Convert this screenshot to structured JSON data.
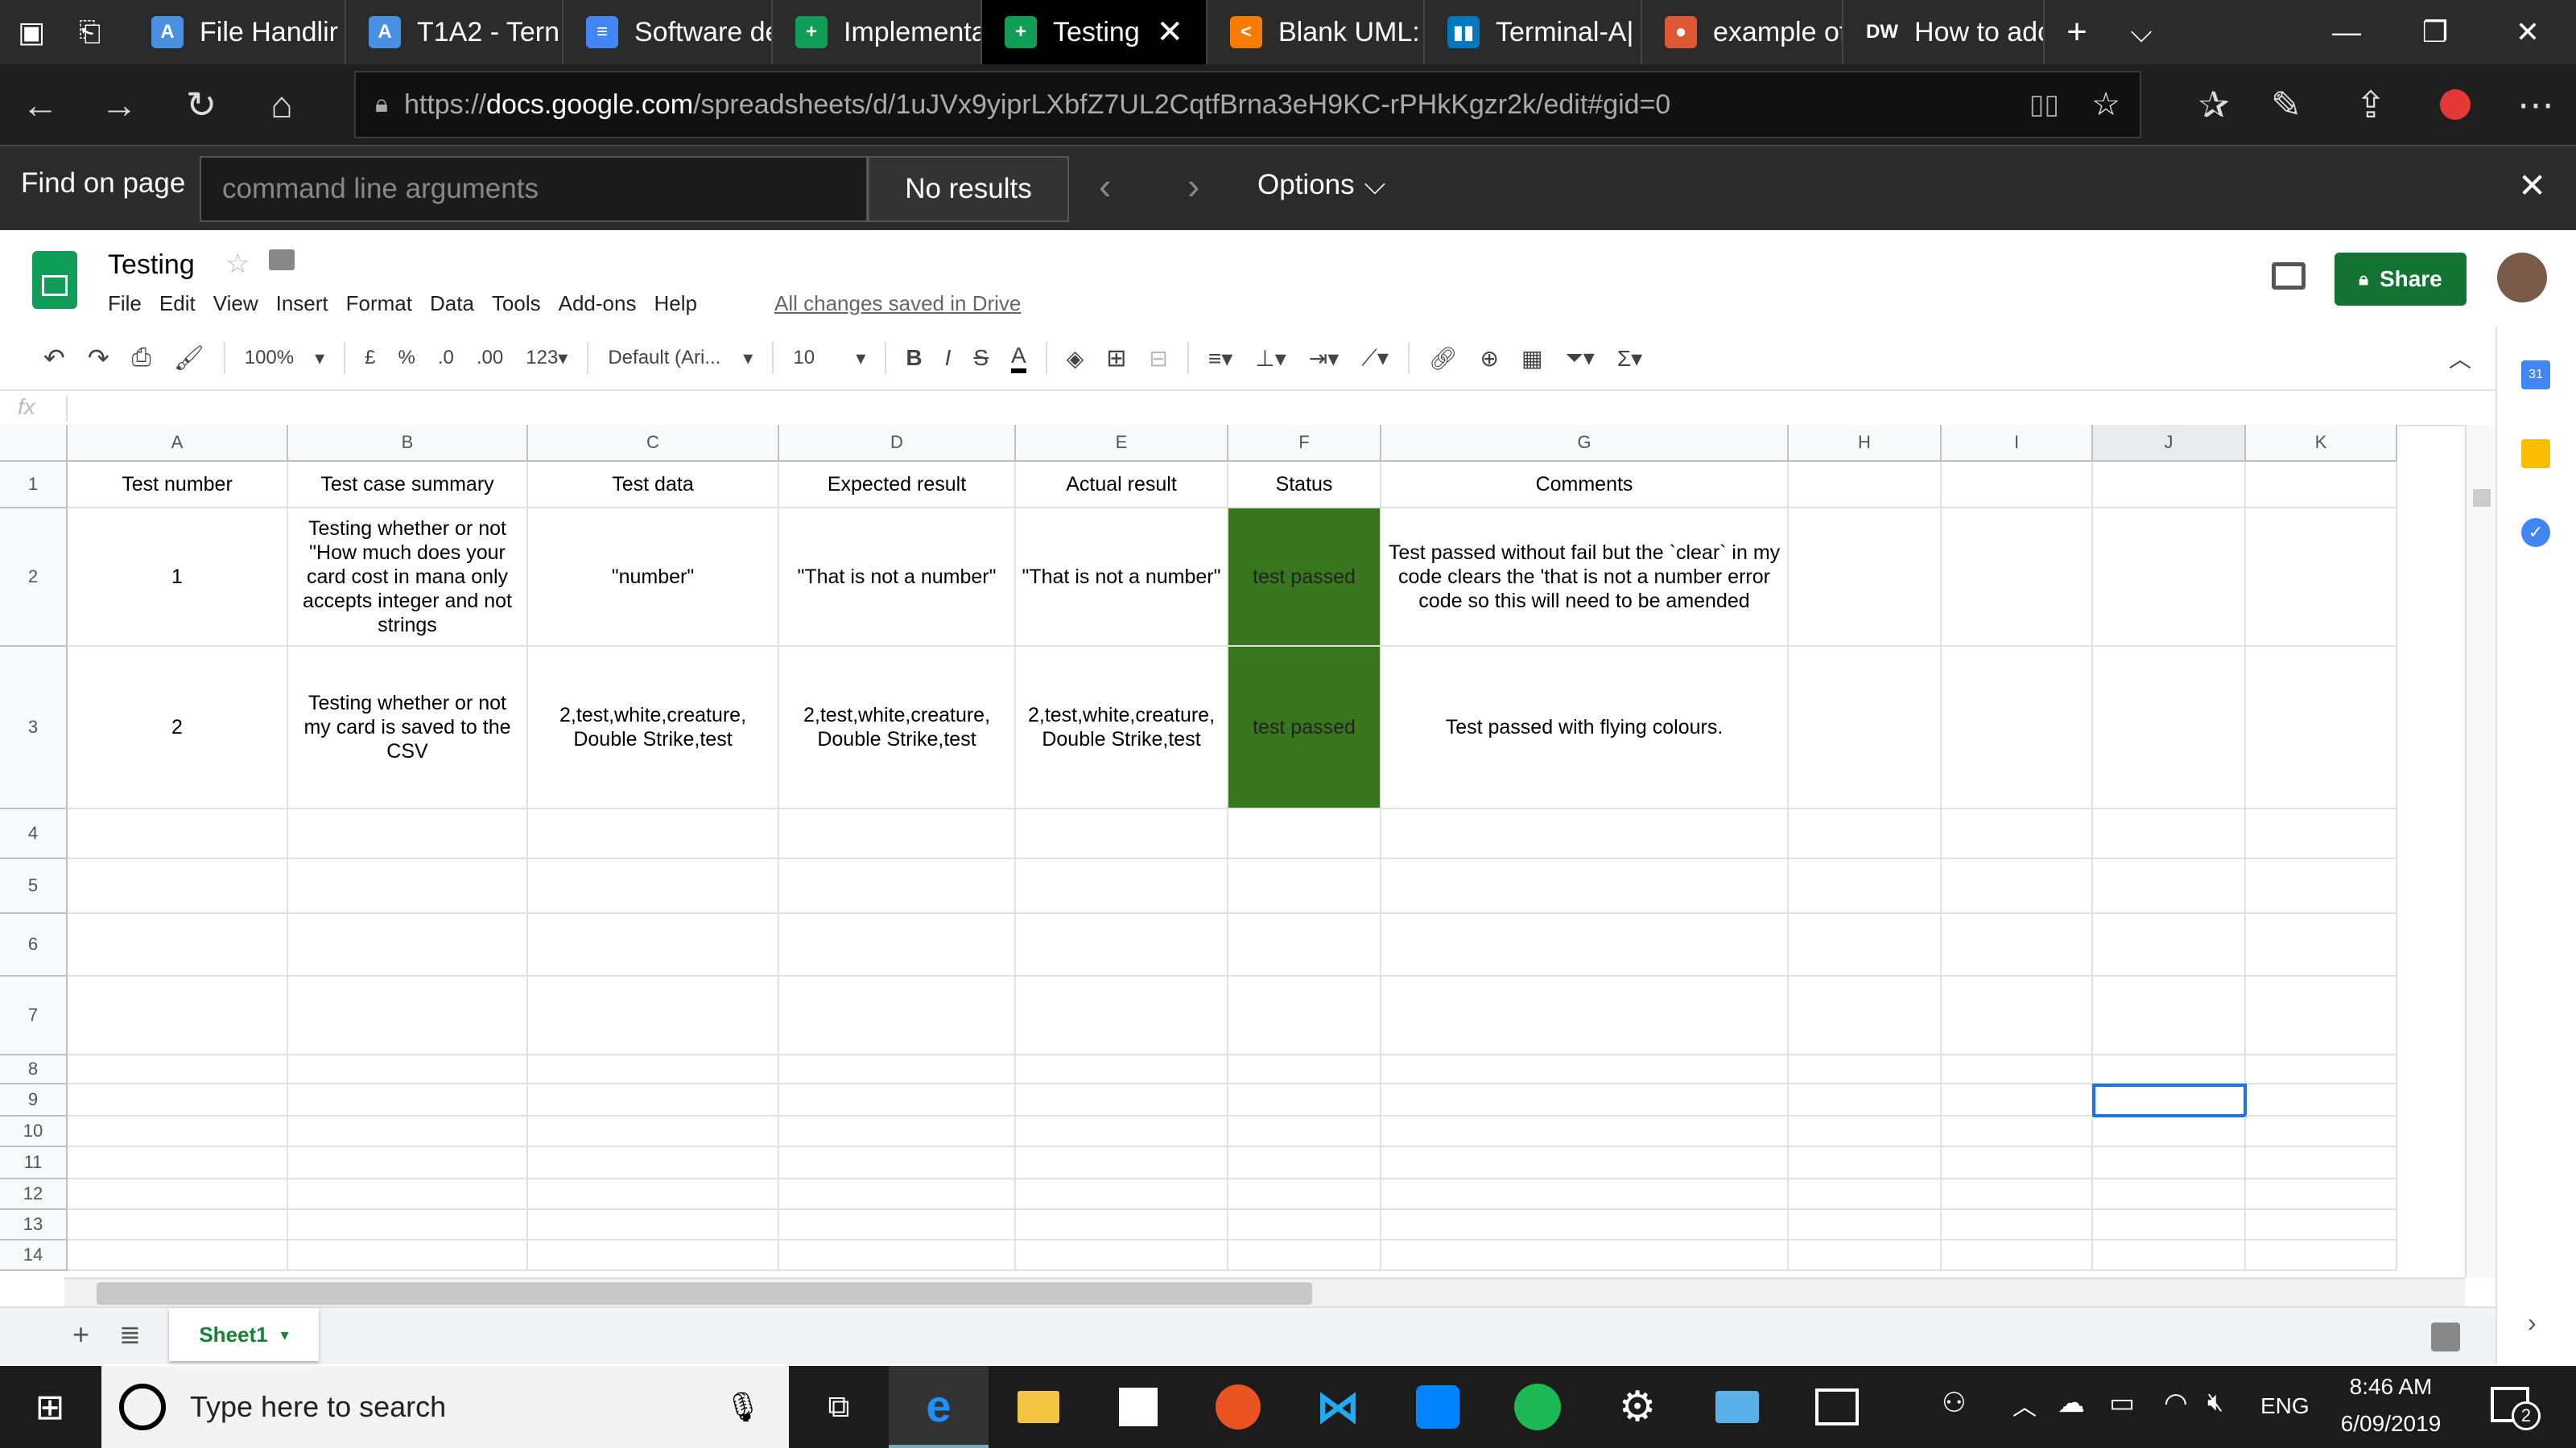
{
  "tabs": [
    {
      "title": "File Handlir",
      "icon": "A",
      "color": "#4a90e2"
    },
    {
      "title": "T1A2 - Tern",
      "icon": "A",
      "color": "#4a90e2"
    },
    {
      "title": "Software de",
      "icon": "≡",
      "color": "#4285f4"
    },
    {
      "title": "Implementa",
      "icon": "+",
      "color": "#0f9d58"
    },
    {
      "title": "Testing",
      "icon": "+",
      "color": "#0f9d58",
      "active": true
    },
    {
      "title": "Blank UML:",
      "icon": "<",
      "color": "#f57c00"
    },
    {
      "title": "Terminal-A|",
      "icon": "▮▮",
      "color": "#0079bf"
    },
    {
      "title": "example of",
      "icon": "●",
      "color": "#de5833"
    },
    {
      "title": "How to adc",
      "icon": "DW",
      "color": "#2b2b2b"
    }
  ],
  "url": {
    "prefix": "https://",
    "host": "docs.google.com",
    "path": "/spreadsheets/d/1uJVx9yiprLXbfZ7UL2CqtfBrna3eH9KC-rPHkKgzr2k/edit#gid=0"
  },
  "find": {
    "label": "Find on page",
    "query": "command line arguments",
    "result": "No results",
    "options": "Options"
  },
  "doc": {
    "title": "Testing",
    "saved": "All changes saved in Drive",
    "share": "Share",
    "menus": [
      "File",
      "Edit",
      "View",
      "Insert",
      "Format",
      "Data",
      "Tools",
      "Add-ons",
      "Help"
    ]
  },
  "toolbar": {
    "zoom": "100%",
    "currency": "£",
    "percent": "%",
    "dec0": ".0",
    "dec00": ".00",
    "fmt": "123",
    "font": "Default (Ari...",
    "size": "10",
    "fx": "fx"
  },
  "columns": [
    "A",
    "B",
    "C",
    "D",
    "E",
    "F",
    "G",
    "H",
    "I",
    "J",
    "K"
  ],
  "rows": [
    "1",
    "2",
    "3",
    "4",
    "5",
    "6",
    "7",
    "8",
    "9",
    "10",
    "11",
    "12",
    "13",
    "14"
  ],
  "cells": [
    [
      "Test number",
      "Test case summary",
      "Test data",
      "Expected result",
      "Actual result",
      "Status",
      "Comments"
    ],
    [
      "1",
      "Testing whether or not \"How much does your card cost in mana only accepts integer and not strings",
      "\"number\"",
      "\"That is not a number\"",
      "\"That is not a number\"",
      "test passed",
      "Test passed without fail but the `clear` in my code clears the 'that is not a number error code so this will need to be amended"
    ],
    [
      "2",
      "Testing whether or not my card is saved to the CSV",
      "2,test,white,creature, Double Strike,test",
      "2,test,white,creature, Double Strike,test",
      "2,test,white,creature, Double Strike,test",
      "test passed",
      "Test passed with flying colours."
    ]
  ],
  "sheet": {
    "name": "Sheet1"
  },
  "taskbar": {
    "search": "Type here to search",
    "lang": "ENG",
    "time": "8:46 AM",
    "date": "6/09/2019",
    "badge": "2"
  }
}
